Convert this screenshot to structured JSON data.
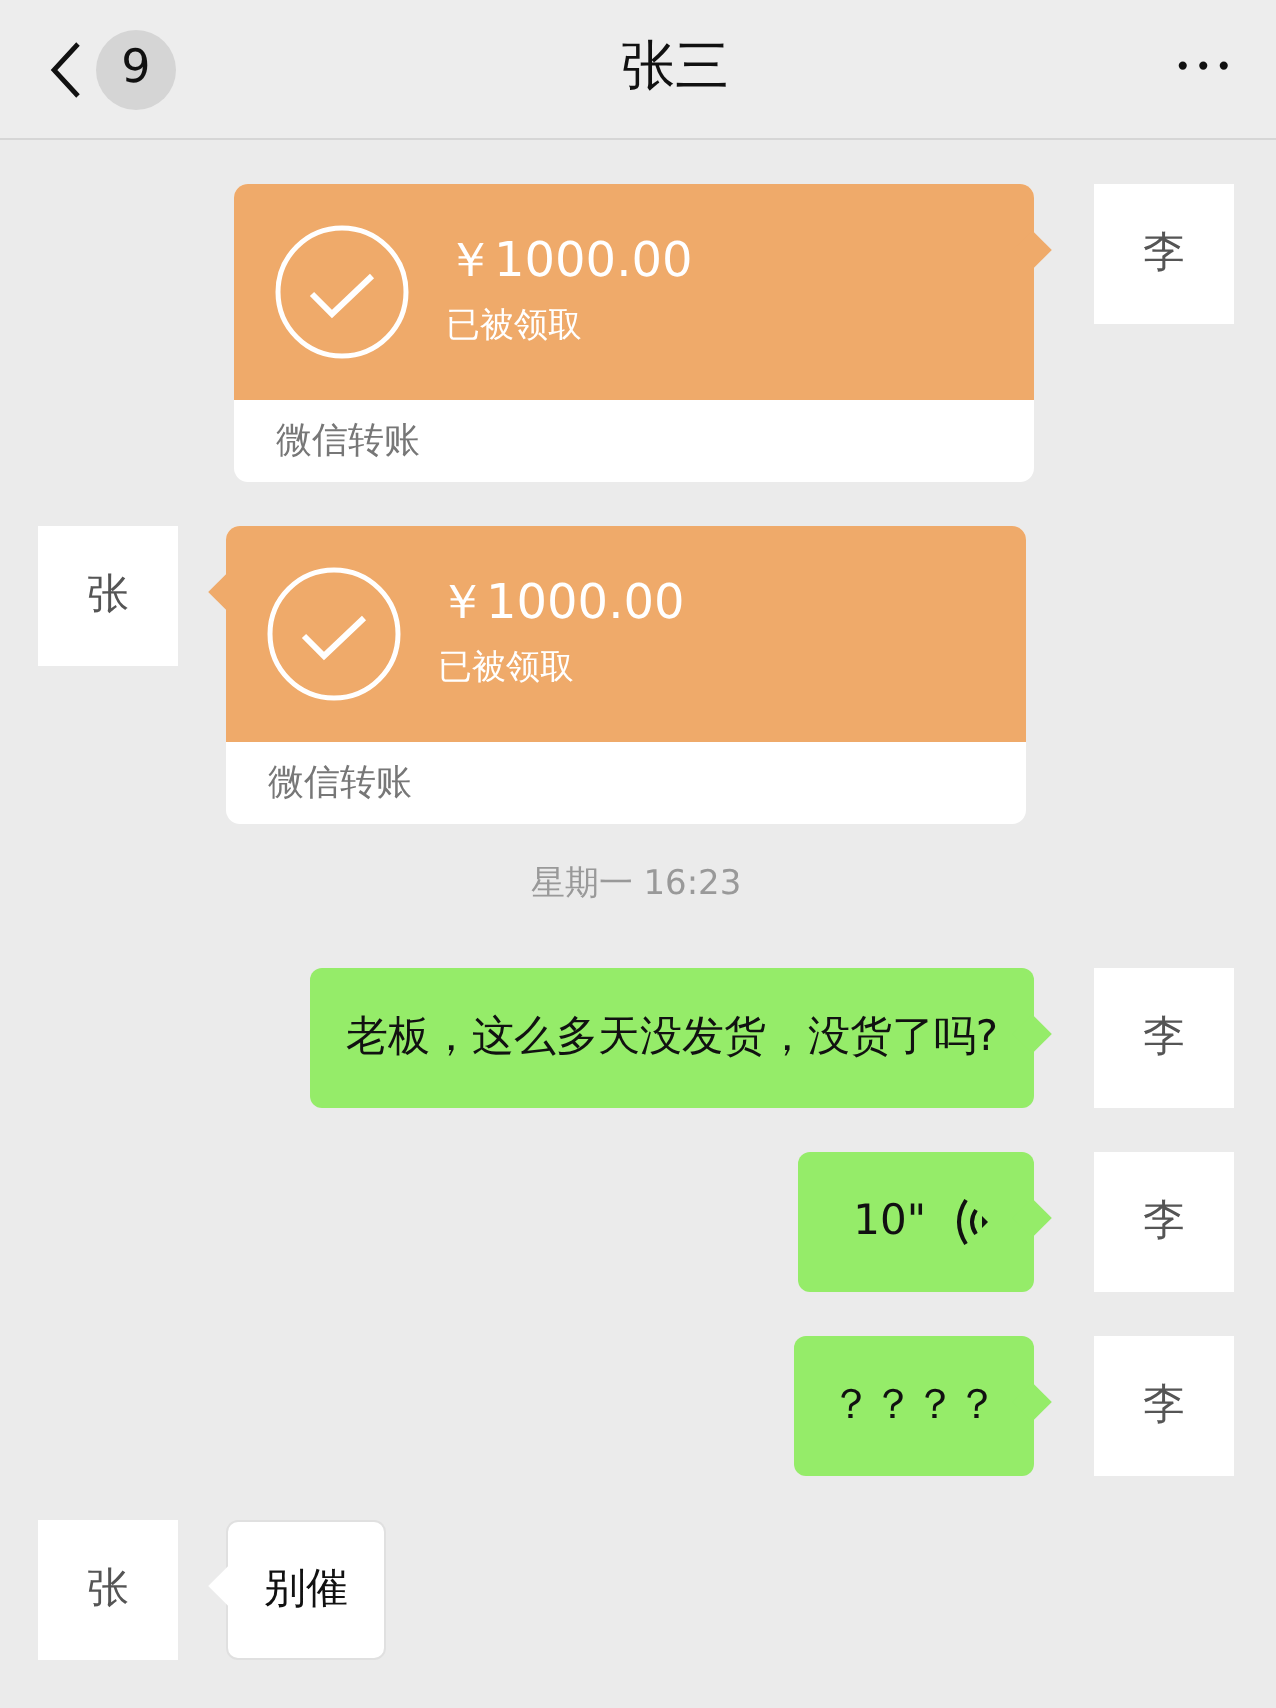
{
  "header": {
    "back_count": "9",
    "title": "张三",
    "more": "•••"
  },
  "messages": [
    {
      "kind": "transfer",
      "outgoing": true,
      "avatar": "李",
      "amount": "￥1000.00",
      "status": "已被领取",
      "footer": "微信转账"
    },
    {
      "kind": "transfer",
      "outgoing": false,
      "avatar": "张",
      "amount": "￥1000.00",
      "status": "已被领取",
      "footer": "微信转账"
    },
    {
      "kind": "time",
      "text": "星期一 16:23"
    },
    {
      "kind": "text",
      "outgoing": true,
      "avatar": "李",
      "text": "老板，这么多天没发货，没货了吗?"
    },
    {
      "kind": "voice",
      "outgoing": true,
      "avatar": "李",
      "text": "10\""
    },
    {
      "kind": "text",
      "outgoing": true,
      "avatar": "李",
      "text": "？？？？"
    },
    {
      "kind": "text",
      "outgoing": false,
      "avatar": "张",
      "text": "别催"
    }
  ]
}
